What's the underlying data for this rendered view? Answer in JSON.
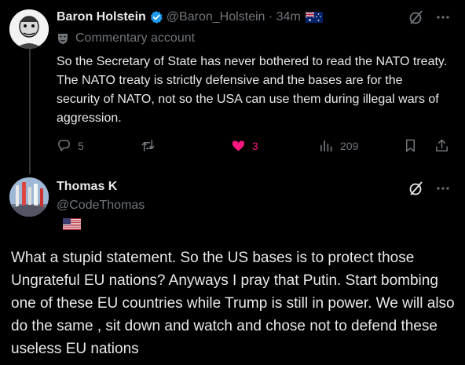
{
  "tweet1": {
    "author_name": "Baron Holstein",
    "handle_time": "@Baron_Holstein · 34m",
    "commentary_label": "Commentary account",
    "text": "So the Secretary of State has never bothered to read the NATO treaty. The NATO treaty is strictly defensive and the bases are for the security of NATO, not so the USA can use them during illegal wars of aggression.",
    "reply_count": "5",
    "like_count": "3",
    "views_count": "209"
  },
  "tweet2": {
    "author_name": "Thomas K",
    "handle": "@CodeThomas",
    "text": "What a stupid  statement. So the US bases is to protect those Ungrateful EU nations? Anyways I pray that Putin. Start bombing one of these EU countries while Trump is still in power. We will also do the same , sit down and watch and chose not to defend these useless EU nations"
  },
  "icons": {
    "verified": "verified-badge-icon",
    "flag1": "australia-flag-icon",
    "flag2": "usa-flag-icon",
    "commentary": "mask-icon",
    "grok": "grok-icon",
    "more": "more-dots-icon",
    "reply": "reply-icon",
    "retweet": "retweet-icon",
    "like": "heart-icon",
    "views": "views-icon",
    "bookmark": "bookmark-icon",
    "share": "share-icon"
  },
  "colors": {
    "background": "#000000",
    "text": "#e7e9ea",
    "secondary": "#71767b",
    "verified": "#1d9bf0",
    "like": "#f91880"
  }
}
